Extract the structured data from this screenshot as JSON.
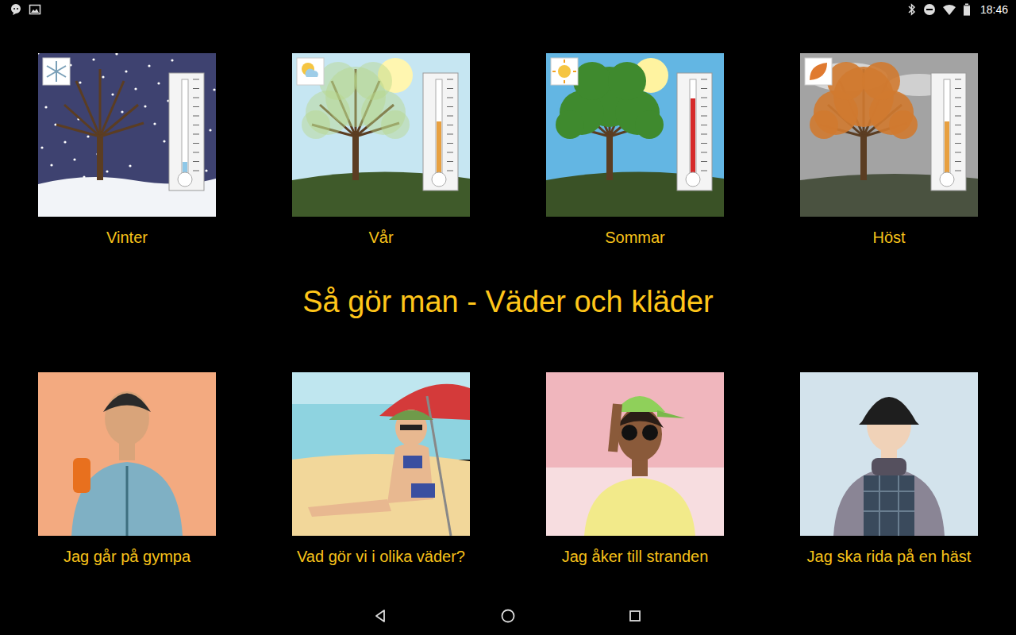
{
  "status_bar": {
    "time": "18:46",
    "battery": {
      "level": 0.95
    }
  },
  "title": "Så gör man - Väder och kläder",
  "seasons": [
    {
      "label": "Vinter",
      "kind": "winter",
      "level": 0.12
    },
    {
      "label": "Vår",
      "kind": "spring",
      "level": 0.55
    },
    {
      "label": "Sommar",
      "kind": "summer",
      "level": 0.8
    },
    {
      "label": "Höst",
      "kind": "autumn",
      "level": 0.55
    }
  ],
  "activities": [
    {
      "label": "Jag går på gympa",
      "kind": "gym"
    },
    {
      "label": "Vad gör vi i olika väder?",
      "kind": "weather"
    },
    {
      "label": "Jag åker till stranden",
      "kind": "beach"
    },
    {
      "label": "Jag ska rida på en häst",
      "kind": "riding"
    }
  ]
}
